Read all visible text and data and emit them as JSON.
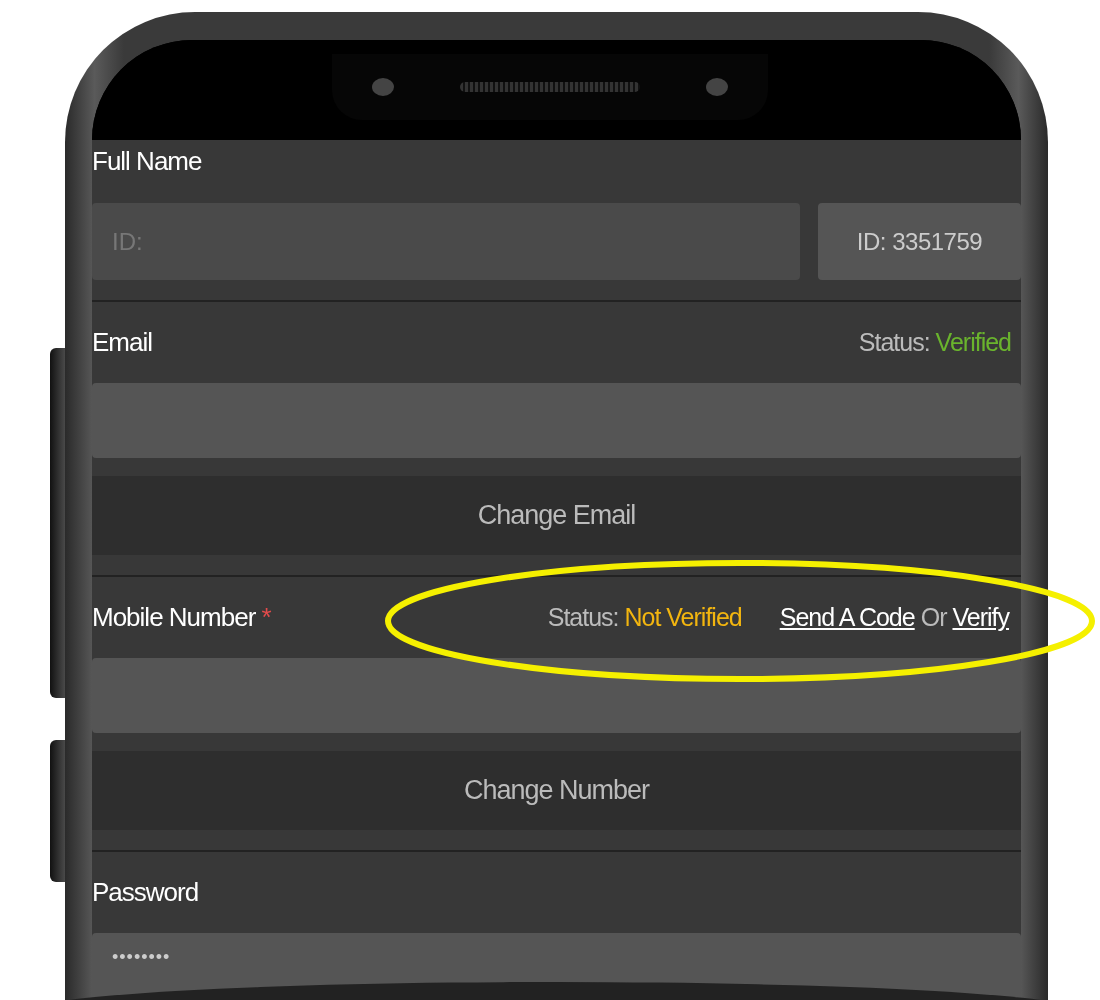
{
  "full_name": {
    "label": "Full Name",
    "id_field": {
      "placeholder": "ID:"
    },
    "id_badge": "ID: 3351759"
  },
  "email": {
    "label": "Email",
    "status_label": "Status:",
    "status": "Verified",
    "verified": true,
    "button": "Change Email"
  },
  "mobile": {
    "label": "Mobile Number",
    "required": true,
    "required_mark": "*",
    "status_label": "Status:",
    "status": "Not Verified",
    "verified": false,
    "links": [
      "Send A Code",
      "Verify"
    ],
    "separator": "Or",
    "button": "Change Number"
  },
  "password": {
    "label": "Password",
    "value": "••••••••"
  }
}
